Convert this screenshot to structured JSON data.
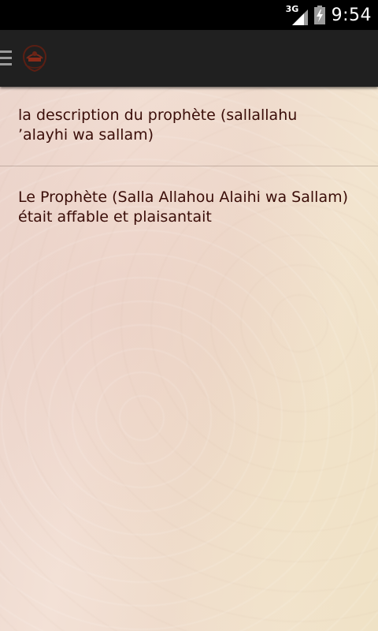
{
  "status_bar": {
    "network_type": "3G",
    "time": "9:54",
    "icons": [
      "signal-icon",
      "battery-icon"
    ]
  },
  "action_bar": {
    "icons": [
      "menu-icon",
      "app-logo-icon"
    ]
  },
  "list": {
    "items": [
      {
        "label": "la description du prophète (sallallahu ’alayhi wa sallam)"
      },
      {
        "label": "Le Prophète (Salla Allahou Alaihi wa Sallam) était affable et plaisantait"
      }
    ]
  },
  "colors": {
    "text": "#3a0d08",
    "action_bar": "#202020",
    "status_bar": "#000000"
  }
}
